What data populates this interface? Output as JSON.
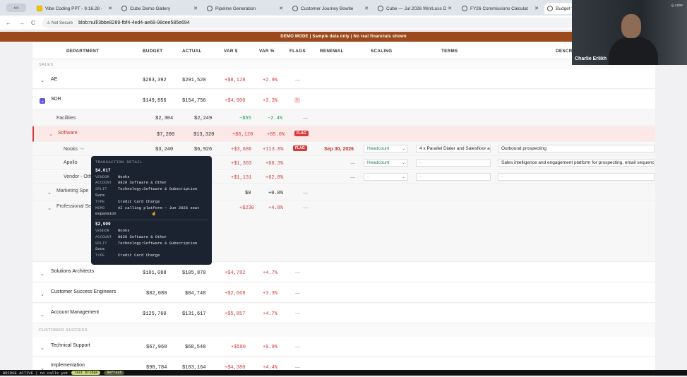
{
  "browser": {
    "tabs": [
      {
        "label": "Vibe Coding PPT - 9.16.28 -"
      },
      {
        "label": "Cube Demo Gallery"
      },
      {
        "label": "Pipeline Generation"
      },
      {
        "label": "Customer Journey Bowtie"
      },
      {
        "label": "Cube — Jul 2026 Win/Loss D"
      },
      {
        "label": "FY26 Commissions Calculat"
      },
      {
        "label": "Budget v"
      }
    ],
    "not_secure": "Not Secure",
    "url": "blob:null/3bbe8289-fbf4-4ed4-ae68-98cee585e694"
  },
  "banner": "DEMO MODE | Sample data only | No real financials shown",
  "columns": [
    "DEPARTMENT",
    "BUDGET",
    "ACTUAL",
    "VAR $",
    "VAR %",
    "FLAGS",
    "RENEWAL",
    "SCALING",
    "TERMS",
    "DESCR"
  ],
  "sections": {
    "sales": "SALES",
    "cs": "CUSTOMER SUCCESS"
  },
  "rows": {
    "ae": {
      "name": "AE",
      "budget": "$283,392",
      "actual": "$291,520",
      "var": "+$8,128",
      "pct": "+2.9%",
      "flag": "—"
    },
    "sdr": {
      "name": "SDR",
      "budget": "$149,856",
      "actual": "$154,756",
      "var": "+$4,900",
      "pct": "+3.3%",
      "flag": "!"
    },
    "facilities": {
      "name": "Facilities",
      "budget": "$2,304",
      "actual": "$2,249",
      "var": "−$55",
      "pct": "−2.4%",
      "flag": "—"
    },
    "software": {
      "name": "Software",
      "budget": "$7,200",
      "actual": "$13,320",
      "var": "+$6,120",
      "pct": "+85.0%",
      "flag": "FLAG"
    },
    "nooks": {
      "name": "Nooks",
      "budget": "$3,240",
      "actual": "$6,926",
      "var": "+$3,686",
      "pct": "+113.8%",
      "flag": "FLAG",
      "renewal": "Sep 30, 2026",
      "scaling": "Headcount",
      "terms": "4 x Parallel Dialer and Salesfloor a",
      "descr": "Outbound prospecting"
    },
    "apollo": {
      "name": "Apollo",
      "var": "+$1,303",
      "pct": "+60.3%",
      "renewal": "—",
      "scaling": "Headcount",
      "terms": "-",
      "descr": "Sales intelligence and engagement platform for prospecting, email sequenc"
    },
    "vendor_other": {
      "name": "Vendor - Oth",
      "var": "+$1,131",
      "pct": "+62.8%",
      "renewal": "—",
      "scaling": "-",
      "terms": "-",
      "descr": "-"
    },
    "marketing": {
      "name": "Marketing Spe",
      "var": "$0",
      "pct": "+0.0%",
      "flag": "—"
    },
    "professional": {
      "name": "Professional Se",
      "var": "+$230",
      "pct": "+4.8%",
      "flag": "—"
    },
    "sa": {
      "name": "Solutions Architects",
      "budget": "$101,088",
      "actual": "$105,870",
      "var": "+$4,782",
      "pct": "+4.7%",
      "flag": "—"
    },
    "cse": {
      "name": "Customer Success Engineers",
      "budget": "$82,080",
      "actual": "$84,748",
      "var": "+$2,668",
      "pct": "+3.3%",
      "flag": "—"
    },
    "am": {
      "name": "Account Management",
      "budget": "$125,760",
      "actual": "$131,617",
      "var": "+$5,857",
      "pct": "+4.7%",
      "flag": "—"
    },
    "ts": {
      "name": "Technical Support",
      "budget": "$67,968",
      "actual": "$68,548",
      "var": "+$580",
      "pct": "+0.9%",
      "flag": "—"
    },
    "impl": {
      "name": "Implementation",
      "budget": "$98,784",
      "actual": "$103,164",
      "var": "+$4,380",
      "pct": "+4.4%",
      "flag": "—"
    }
  },
  "tooltip": {
    "heading": "TRANSACTION DETAIL",
    "tx1": {
      "amount": "$4,017",
      "vendor": "Nooks",
      "account": "8820 Software & Other",
      "split": "Technology:Software & Subscription",
      "split2": "Svcs",
      "type": "Credit Card Charge",
      "memo": "AI calling platform — Jun 2026 seat",
      "memo2": "expansion"
    },
    "tx2": {
      "amount": "$2,909",
      "vendor": "Nooks",
      "account": "8820 Software & Other",
      "split": "Technology:Software & Subscription",
      "split2": "Svcs",
      "type": "Credit Card Charge"
    },
    "labels": {
      "vendor": "VENDOR",
      "account": "ACCOUNT",
      "split": "SPLIT",
      "type": "TYPE",
      "memo": "MEMO"
    }
  },
  "video": {
    "name": "Charlie Erlikh",
    "logo": "◎ cube"
  },
  "statusbar": {
    "text": "BRIDGE ACTIVE | no calls yet",
    "btn1": "Test bridge",
    "btn2": "Refresh"
  },
  "colors": {
    "banner": "#9c4a1c",
    "accent": "#6359e9",
    "negative": "#d03b3b",
    "positive": "#1e9a55",
    "flag": "#d93a3a"
  }
}
